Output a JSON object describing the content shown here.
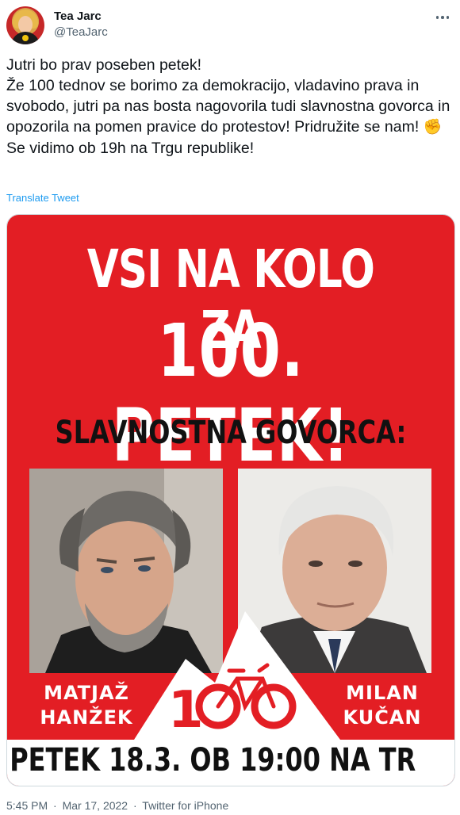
{
  "author": {
    "display_name": "Tea Jarc",
    "handle": "@TeaJarc"
  },
  "tweet": {
    "text_before_emoji": "Jutri bo prav poseben petek!\nŽe 100 tednov se borimo za demokracijo, vladavino prava in svobodo, jutri pa nas bosta nagovorila tudi slavnostna govorca in opozorila na pomen pravice do protestov! Pridružite se nam! ",
    "emoji": "✊",
    "text_after_emoji": " Se vidimo ob 19h na Trgu republike!",
    "translate_label": "Translate Tweet"
  },
  "poster": {
    "headline_line1": "VSI NA KOLO ZA",
    "headline_line2": "100. PETEK!",
    "subheading": "SLAVNOSTNA GOVORCA:",
    "speaker_left": {
      "first": "MATJAŽ",
      "last": "HANŽEK"
    },
    "speaker_right": {
      "first": "MILAN",
      "last": "KUČAN"
    },
    "logo_text": "100",
    "date_line": "PETEK 18.3. OB 19:00 NA TR",
    "colors": {
      "background": "#e31e24",
      "text_light": "#ffffff",
      "text_dark": "#111111"
    }
  },
  "meta": {
    "time": "5:45 PM",
    "date": "Mar 17, 2022",
    "source": "Twitter for iPhone",
    "separator": "·"
  },
  "icons": [
    "more-icon",
    "bicycle-icon",
    "fist-emoji"
  ]
}
